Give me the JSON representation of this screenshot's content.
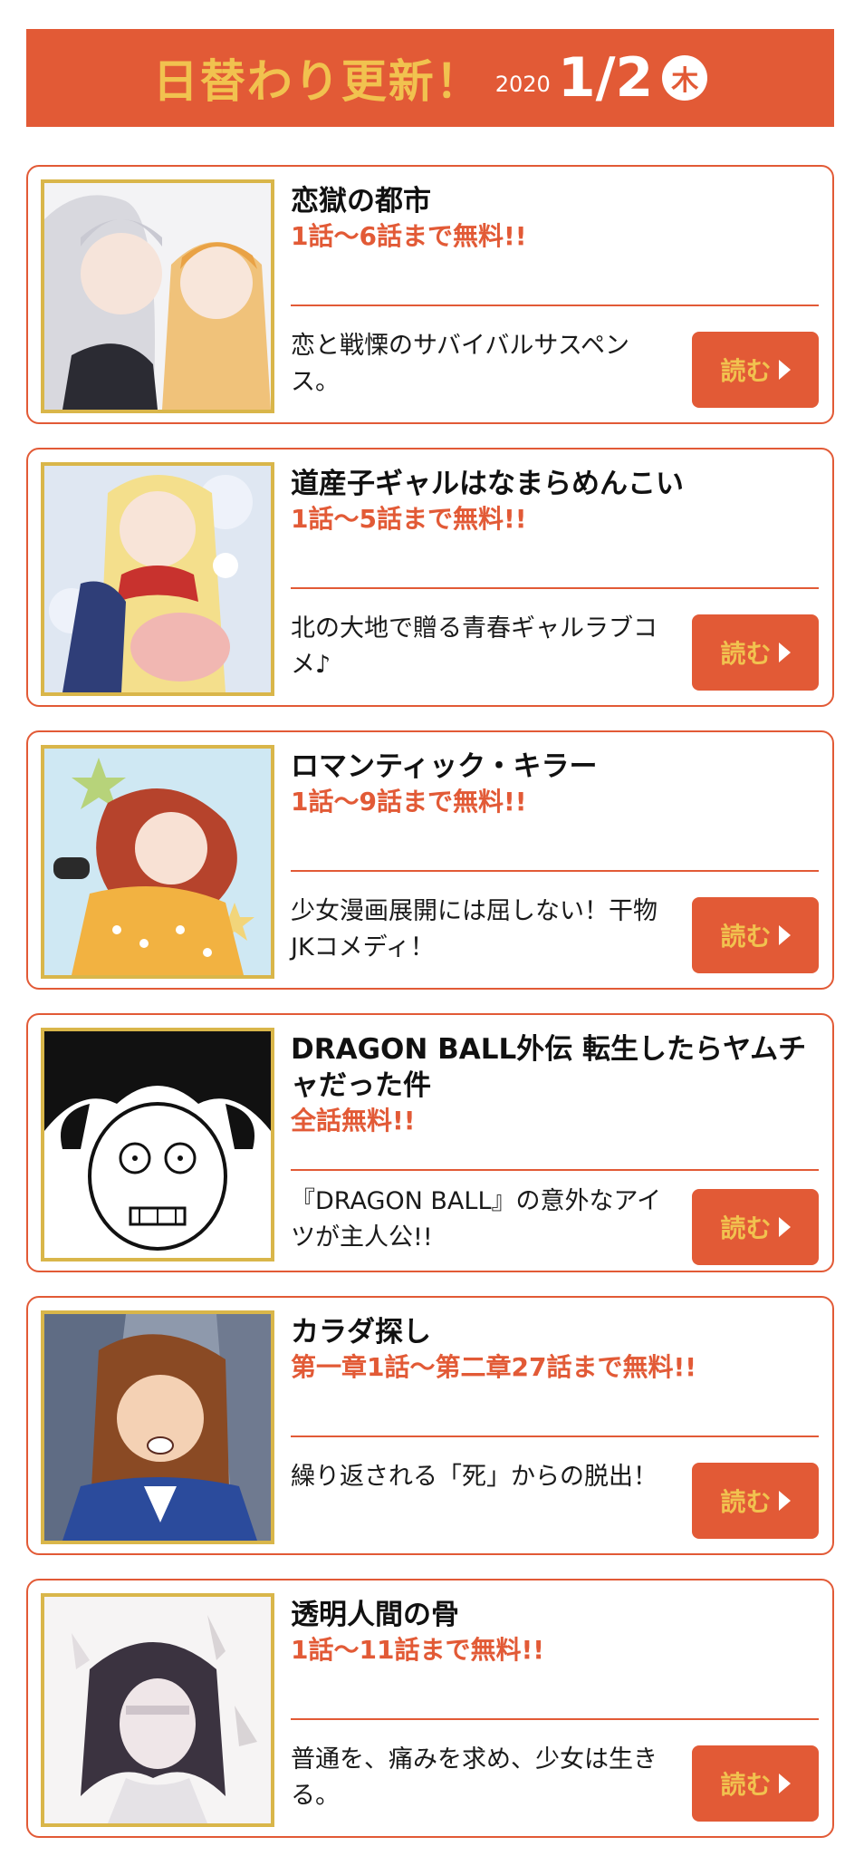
{
  "banner": {
    "title": "日替わり更新！",
    "year": "2020",
    "date": "1/2",
    "weekday": "木"
  },
  "colors": {
    "accent": "#e25a36",
    "gold": "#f1c24f",
    "thumb_border": "#d9b64a"
  },
  "items": [
    {
      "title": "恋獄の都市",
      "free": "1話〜6話まで無料!!",
      "desc": "恋と戦慄のサバイバルサスペンス。",
      "button": "読む"
    },
    {
      "title": "道産子ギャルはなまらめんこい",
      "free": "1話〜5話まで無料!!",
      "desc": "北の大地で贈る青春ギャルラブコメ♪",
      "button": "読む"
    },
    {
      "title": "ロマンティック・キラー",
      "free": "1話〜9話まで無料!!",
      "desc": "少女漫画展開には屈しない！干物JKコメディ！",
      "button": "読む"
    },
    {
      "title": "DRAGON BALL外伝 転生したらヤムチャだった件",
      "free": "全話無料!!",
      "desc": "『DRAGON BALL』の意外なアイツが主人公!!",
      "button": "読む"
    },
    {
      "title": "カラダ探し",
      "free": "第一章1話〜第二章27話まで無料!!",
      "desc": "繰り返される「死」からの脱出！",
      "button": "読む"
    },
    {
      "title": "透明人間の骨",
      "free": "1話〜11話まで無料!!",
      "desc": "普通を、痛みを求め、少女は生きる。",
      "button": "読む"
    }
  ]
}
